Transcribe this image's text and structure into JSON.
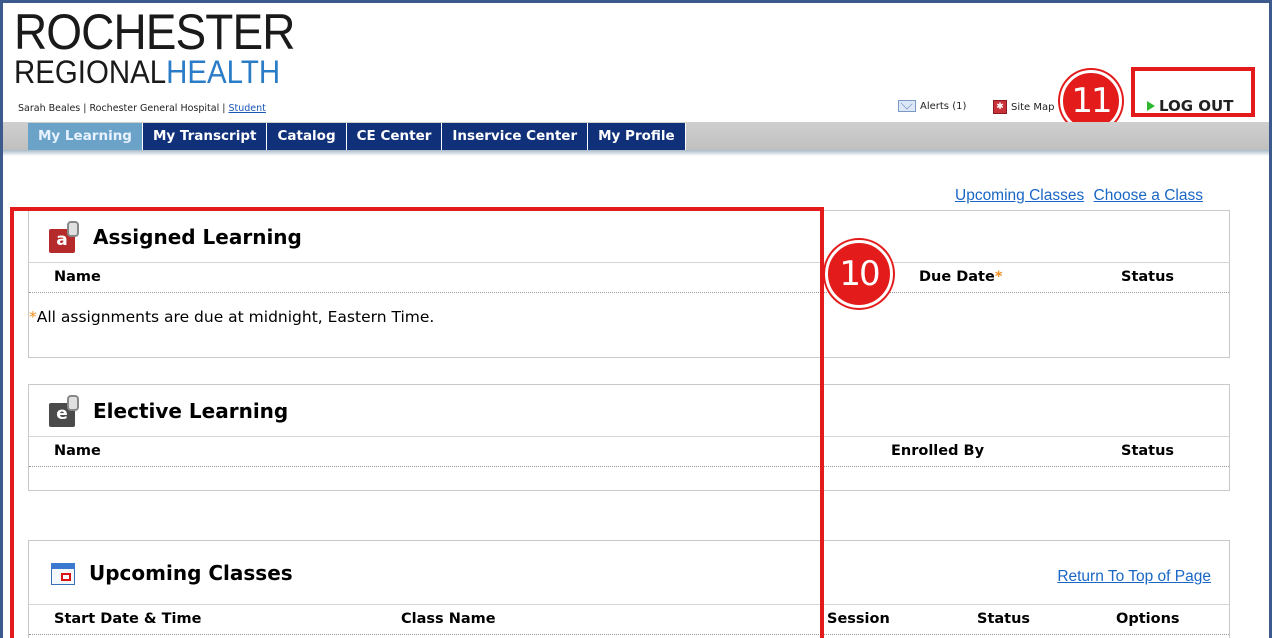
{
  "brand": {
    "line1": "ROCHESTER",
    "line2_a": "REGIONAL",
    "line2_b": "HEALTH"
  },
  "user": {
    "text": "Sarah Beales | Rochester General Hospital | ",
    "role_link": "Student"
  },
  "utility": {
    "alerts": "Alerts (1)",
    "site_map": "Site Map",
    "logout": "LOG OUT"
  },
  "annotations": {
    "badge_11": "11",
    "badge_10": "10"
  },
  "tabs": [
    {
      "label": "My Learning",
      "active": true
    },
    {
      "label": "My Transcript"
    },
    {
      "label": "Catalog"
    },
    {
      "label": "CE Center"
    },
    {
      "label": "Inservice Center"
    },
    {
      "label": "My Profile"
    }
  ],
  "top_links": {
    "upcoming": "Upcoming Classes",
    "choose": "Choose a Class"
  },
  "assigned": {
    "title": "Assigned Learning",
    "cols": {
      "name": "Name",
      "due": "Due Date",
      "due_mark": "*",
      "status": "Status"
    },
    "note_mark": "*",
    "note": "All assignments are due at midnight, Eastern Time."
  },
  "elective": {
    "title": "Elective Learning",
    "cols": {
      "name": "Name",
      "enrolled": "Enrolled By",
      "status": "Status"
    }
  },
  "upcoming": {
    "title": "Upcoming Classes",
    "return_link": "Return To Top of Page",
    "cols": {
      "start": "Start Date & Time",
      "class": "Class Name",
      "session": "Session",
      "status": "Status",
      "options": "Options"
    }
  },
  "colors": {
    "nav_tab": "#10317a",
    "nav_tab_active": "#6aa2c8",
    "annotation_red": "#e31b1b",
    "link": "#1a66c4",
    "brand_accent": "#2a7cc7"
  }
}
